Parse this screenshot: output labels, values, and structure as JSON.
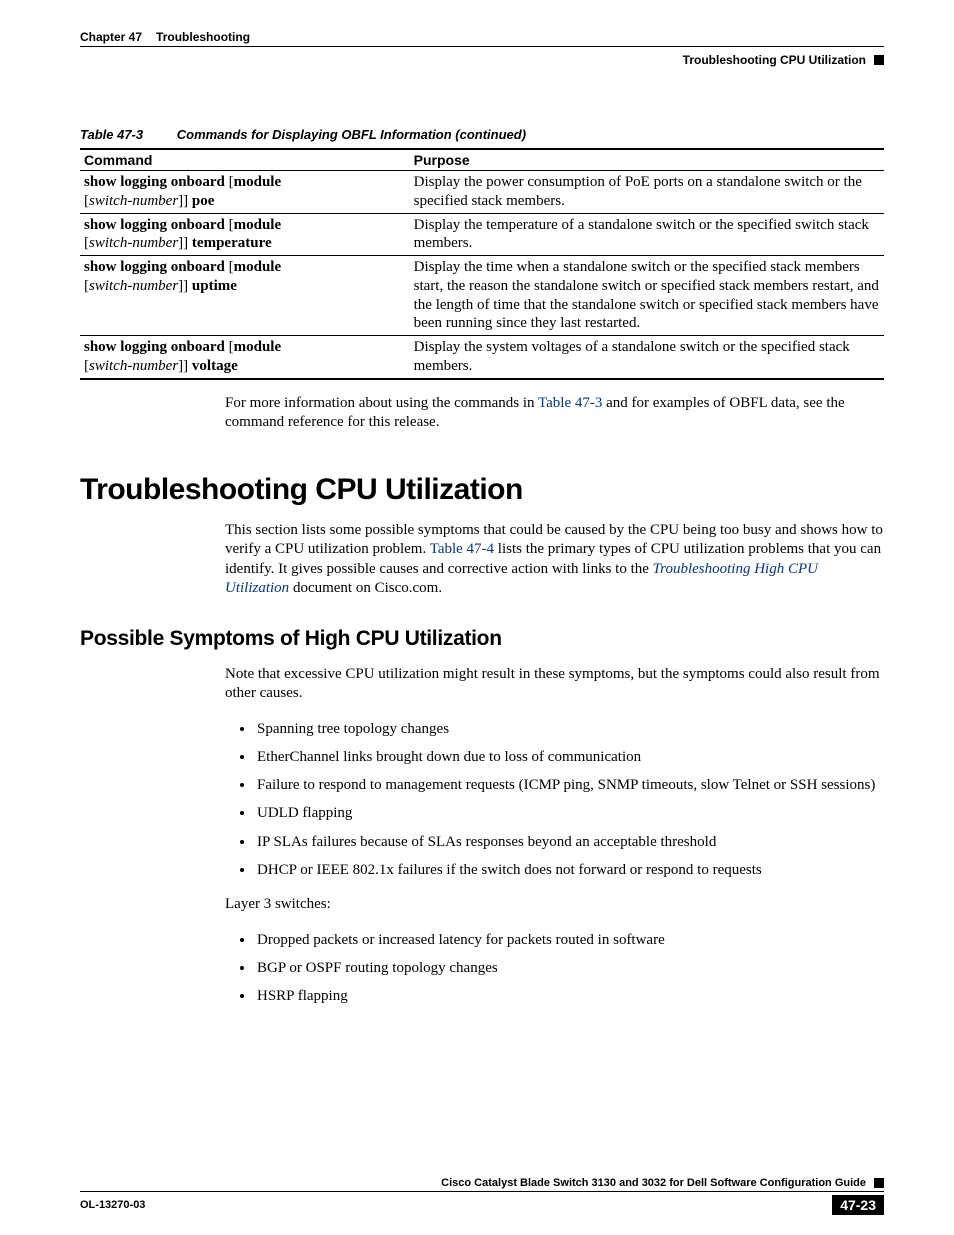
{
  "header": {
    "chapter_label": "Chapter 47",
    "chapter_title": "Troubleshooting",
    "section_right": "Troubleshooting CPU Utilization"
  },
  "table": {
    "caption_num": "Table 47-3",
    "caption_title": "Commands for Displaying OBFL Information (continued)",
    "col1": "Command",
    "col2": "Purpose",
    "rows": [
      {
        "cmd": {
          "pre": "show logging onboard",
          "open": " [",
          "mod": "module",
          "mid": " [",
          "arg": "switch-number",
          "close": "]] ",
          "suf": "poe"
        },
        "purpose": "Display the power consumption of PoE ports on a standalone switch or the specified stack members."
      },
      {
        "cmd": {
          "pre": "show logging onboard",
          "open": " [",
          "mod": "module",
          "mid": " [",
          "arg": "switch-number",
          "close": "]] ",
          "suf": "temperature"
        },
        "purpose": "Display the temperature of a standalone switch or the specified switch stack members."
      },
      {
        "cmd": {
          "pre": "show logging onboard",
          "open": " [",
          "mod": "module",
          "mid": " [",
          "arg": "switch-number",
          "close": "]] ",
          "suf": "uptime"
        },
        "purpose": "Display the time when a standalone switch or the specified stack members start, the reason the standalone switch or specified stack members restart, and the length of time that the standalone switch or specified stack members have been running since they last restarted."
      },
      {
        "cmd": {
          "pre": "show logging onboard",
          "open": " [",
          "mod": "module",
          "mid": " [",
          "arg": "switch-number",
          "close": "]] ",
          "suf": "voltage"
        },
        "purpose": "Display the system voltages of a standalone switch or the specified stack members."
      }
    ]
  },
  "para_after_table": {
    "t1": "For more information about using the commands in ",
    "xref": "Table 47-3",
    "t2": " and for examples of OBFL data, see the command reference for this release."
  },
  "h1": "Troubleshooting CPU Utilization",
  "para_h1": {
    "t1": "This section lists some possible symptoms that could be caused by the CPU being too busy and shows how to verify a CPU utilization problem. ",
    "xref": "Table 47-4",
    "t2": " lists the primary types of CPU utilization problems that you can identify. It gives possible causes and corrective action with links to the ",
    "doclink": "Troubleshooting High CPU Utilization",
    "t3": " document on Cisco.com."
  },
  "h2": "Possible Symptoms of High CPU Utilization",
  "para_h2": "Note that excessive CPU utilization might result in these symptoms, but the symptoms could also result from other causes.",
  "bullets1": [
    "Spanning tree topology changes",
    "EtherChannel links brought down due to loss of communication",
    "Failure to respond to management requests (ICMP ping, SNMP timeouts, slow Telnet or SSH sessions)",
    "UDLD flapping",
    "IP SLAs failures because of SLAs responses beyond an acceptable threshold",
    "DHCP or IEEE 802.1x failures if the switch does not forward or respond to requests"
  ],
  "layer3_label": "Layer 3 switches:",
  "bullets2": [
    "Dropped packets or increased latency for packets routed in software",
    "BGP or OSPF routing topology changes",
    "HSRP flapping"
  ],
  "footer": {
    "guide": "Cisco Catalyst Blade Switch 3130 and 3032 for Dell Software Configuration Guide",
    "docid": "OL-13270-03",
    "page": "47-23"
  }
}
